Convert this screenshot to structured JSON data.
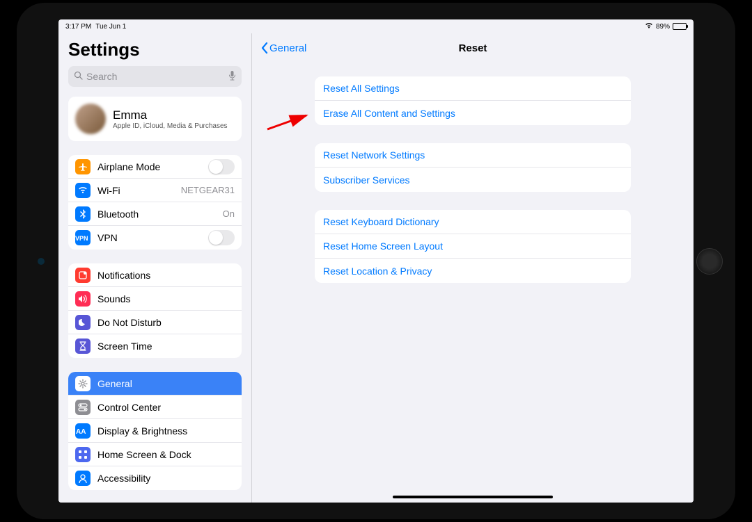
{
  "status": {
    "time": "3:17 PM",
    "date": "Tue Jun 1",
    "battery": "89%"
  },
  "sidebar": {
    "title": "Settings",
    "search_placeholder": "Search",
    "profile": {
      "name": "Emma",
      "subtitle": "Apple ID, iCloud, Media & Purchases"
    },
    "group1": [
      {
        "icon": "airplane",
        "label": "Airplane Mode",
        "type": "toggle",
        "color": "#ff9500"
      },
      {
        "icon": "wifi",
        "label": "Wi-Fi",
        "value": "NETGEAR31",
        "color": "#007aff"
      },
      {
        "icon": "bluetooth",
        "label": "Bluetooth",
        "value": "On",
        "color": "#007aff"
      },
      {
        "icon": "vpn",
        "label": "VPN",
        "type": "toggle",
        "color": "#007aff"
      }
    ],
    "group2": [
      {
        "icon": "bell",
        "label": "Notifications",
        "color": "#ff3b30"
      },
      {
        "icon": "speaker",
        "label": "Sounds",
        "color": "#ff2d55"
      },
      {
        "icon": "moon",
        "label": "Do Not Disturb",
        "color": "#5856d6"
      },
      {
        "icon": "hourglass",
        "label": "Screen Time",
        "color": "#5856d6"
      }
    ],
    "group3": [
      {
        "icon": "gear",
        "label": "General",
        "color": "#8e8e93",
        "selected": true
      },
      {
        "icon": "switches",
        "label": "Control Center",
        "color": "#8e8e93"
      },
      {
        "icon": "AA",
        "label": "Display & Brightness",
        "color": "#007aff"
      },
      {
        "icon": "grid",
        "label": "Home Screen & Dock",
        "color": "#4d68ef"
      },
      {
        "icon": "person",
        "label": "Accessibility",
        "color": "#007aff"
      }
    ]
  },
  "detail": {
    "back_label": "General",
    "title": "Reset",
    "groups": [
      [
        "Reset All Settings",
        "Erase All Content and Settings"
      ],
      [
        "Reset Network Settings",
        "Subscriber Services"
      ],
      [
        "Reset Keyboard Dictionary",
        "Reset Home Screen Layout",
        "Reset Location & Privacy"
      ]
    ]
  }
}
